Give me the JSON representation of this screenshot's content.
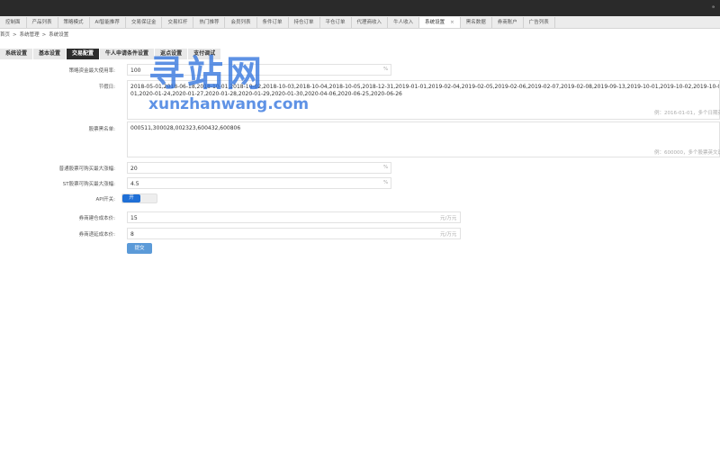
{
  "topbar": {
    "mark": "ᵃ"
  },
  "tabs": [
    {
      "label": "控制面"
    },
    {
      "label": "产品列表"
    },
    {
      "label": "策略模式"
    },
    {
      "label": "AI智能推荐"
    },
    {
      "label": "交易保证金"
    },
    {
      "label": "交易杠杆"
    },
    {
      "label": "热门推荐"
    },
    {
      "label": "会员列表"
    },
    {
      "label": "条件订单"
    },
    {
      "label": "持仓订单"
    },
    {
      "label": "平仓订单"
    },
    {
      "label": "代理商收入"
    },
    {
      "label": "牛人收入"
    },
    {
      "label": "系统设置",
      "active": true
    },
    {
      "label": "黑名数据"
    },
    {
      "label": "券商账户"
    },
    {
      "label": "广告列表"
    }
  ],
  "tab_close_glyph": "×",
  "breadcrumb": {
    "items": [
      "首页",
      "系统管理",
      "系统设置"
    ],
    "sep": ">"
  },
  "subtabs": [
    {
      "label": "系统设置"
    },
    {
      "label": "基本设置"
    },
    {
      "label": "交易配置",
      "active": true
    },
    {
      "label": "牛人申请条件设置"
    },
    {
      "label": "返点设置"
    },
    {
      "label": "支付调试"
    }
  ],
  "form": {
    "max_use_rate": {
      "label": "策略资金最大使用率:",
      "value": "100",
      "unit": "%"
    },
    "holidays": {
      "label": "节假日:",
      "line1": "2018-05-01,2018-06-18,2018-10-01,2018-10-02,2018-10-03,2018-10-04,2018-10-05,2018-12-31,2019-01-01,2019-02-04,2019-02-05,2019-02-06,2019-02-07,2019-02-08,2019-09-13,2019-10-01,2019-10-02,2019-10-03,2019-10-04,2019-10-07,2020-01-01,",
      "line2": "01,2020-01-24,2020-01-27,2020-01-28,2020-01-29,2020-01-30,2020-04-06,2020-06-25,2020-06-26",
      "hint": "例：2016-01-01，多个日期英文逗号"
    },
    "stock_blacklist": {
      "label": "股票黑名单:",
      "value": "000511,300028,002323,600432,600806",
      "hint": "例：600000，多个股票英文逗号"
    },
    "normal_max_gain": {
      "label": "普通股票可购买最大涨幅:",
      "value": "20",
      "unit": "%"
    },
    "st_max_gain": {
      "label": "ST股票可购买最大涨幅:",
      "value": "4.5",
      "unit": "%"
    },
    "api_switch": {
      "label": "API开关:",
      "state_label": "开",
      "on": true
    },
    "broker_open_cost": {
      "label": "券商建仓成本价:",
      "value": "15",
      "unit": "元/万元"
    },
    "broker_renew_cost": {
      "label": "券商递延成本价:",
      "value": "8",
      "unit": "元/万元"
    },
    "submit_label": "提交"
  },
  "watermark": {
    "cn": "寻站网",
    "en": "xunzhanwang.com"
  }
}
